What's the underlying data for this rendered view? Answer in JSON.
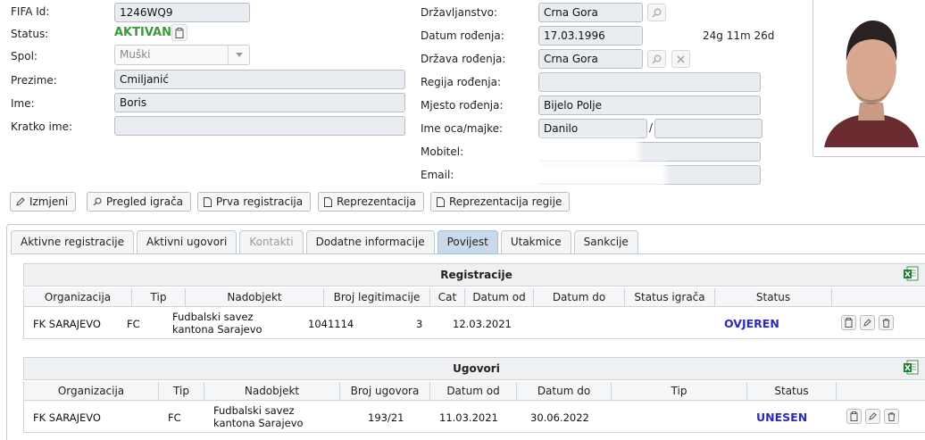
{
  "form": {
    "fifa_id_label": "FIFA Id:",
    "fifa_id": "1246WQ9",
    "status_label": "Status:",
    "status": "AKTIVAN",
    "spol_label": "Spol:",
    "spol_value": "Muški",
    "prezime_label": "Prezime:",
    "prezime": "Cmiljanić",
    "ime_label": "Ime:",
    "ime": "Boris",
    "kratko_label": "Kratko ime:",
    "kratko": "",
    "drzavljanstvo_label": "Državljanstvo:",
    "drzavljanstvo": "Crna Gora",
    "datum_label": "Datum rođenja:",
    "datum": "17.03.1996",
    "age": "24g 11m 26d",
    "drzava_label": "Država rođenja:",
    "drzava": "Crna Gora",
    "regija_label": "Regija rođenja:",
    "regija": "",
    "mjesto_label": "Mjesto rođenja:",
    "mjesto": "Bijelo Polje",
    "roditelji_label": "Ime oca/majke:",
    "otac": "Danilo",
    "separator": "/",
    "majka": "",
    "mobitel_label": "Mobitel:",
    "mobitel": "",
    "email_label": "Email:",
    "email": ""
  },
  "actions": {
    "izmijeni": "Izmjeni",
    "pregled": "Pregled igrača",
    "prva": "Prva registracija",
    "reprezentacija": "Reprezentacija",
    "reprezentacija_regije": "Reprezentacija regije"
  },
  "tabs": [
    "Aktivne registracije",
    "Aktivni ugovori",
    "Kontakti",
    "Dodatne informacije",
    "Povijest",
    "Utakmice",
    "Sankcije"
  ],
  "registracije": {
    "title": "Registracije",
    "headers": [
      "Organizacija",
      "Tip",
      "Nadobjekt",
      "Broj legitimacije",
      "Cat",
      "Datum od",
      "Datum do",
      "Status igrača",
      "Status"
    ],
    "row": {
      "organizacija": "FK SARAJEVO",
      "tip": "FC",
      "nadobjekt_1": "Fudbalski savez",
      "nadobjekt_2": "kantona Sarajevo",
      "broj": "1041114",
      "cat": "3",
      "datum_od": "12.03.2021",
      "datum_do": "",
      "status_igraca": "",
      "status": "OVJEREN"
    }
  },
  "ugovori": {
    "title": "Ugovori",
    "headers": [
      "Organizacija",
      "Tip",
      "Nadobjekt",
      "Broj ugovora",
      "Datum od",
      "Datum do",
      "Tip",
      "Status"
    ],
    "row": {
      "organizacija": "FK SARAJEVO",
      "tip": "FC",
      "nadobjekt_1": "Fudbalski savez",
      "nadobjekt_2": "kantona Sarajevo",
      "broj": "193/21",
      "datum_od": "11.03.2021",
      "datum_do": "30.06.2022",
      "tip2": "",
      "status": "UNESEN"
    }
  },
  "colors": {
    "active_status": "#3a9a3a",
    "row_status": "#2b2bb8",
    "active_tab": "#c8d9ea"
  }
}
